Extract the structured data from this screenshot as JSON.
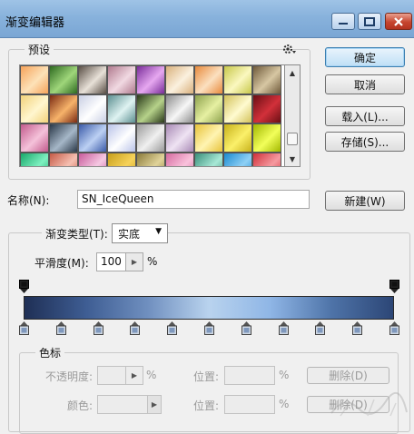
{
  "window": {
    "title": "渐变编辑器"
  },
  "presets": {
    "label": "预设",
    "swatches": [
      [
        "#f6a35a",
        "#fde2b8"
      ],
      [
        "#2e6a20",
        "#9fd67a"
      ],
      [
        "#5a4f46",
        "#e8e1d8"
      ],
      [
        "#b07a8e",
        "#f1d9e2"
      ],
      [
        "#7a2d9a",
        "#e6a8f0"
      ],
      [
        "#d9b07c",
        "#fbf1df"
      ],
      [
        "#e88a3c",
        "#fbe0c0"
      ],
      [
        "#c8c84a",
        "#fbf8c0"
      ],
      [
        "#6f5a3a",
        "#d7c7a3"
      ],
      [
        "#f2d27a",
        "#fff6cf"
      ],
      [
        "#7a2a12",
        "#f7b36a"
      ],
      [
        "#c9cfe4",
        "#ffffff"
      ],
      [
        "#5d8f91",
        "#dff3f2"
      ],
      [
        "#2a3a1a",
        "#b6d28a"
      ],
      [
        "#8c8c8c",
        "#f7f7f7"
      ],
      [
        "#8ea24d",
        "#e6f0a2"
      ],
      [
        "#d3c25a",
        "#fffbd0"
      ],
      [
        "#6a0f14",
        "#d2303a"
      ],
      [
        "#c25a8c",
        "#f5c2da"
      ],
      [
        "#2a3848",
        "#a6b7c8"
      ],
      [
        "#3a5aa8",
        "#bcd0f3"
      ],
      [
        "#b9c3e9",
        "#ffffff"
      ],
      [
        "#9a9a9a",
        "#f0f0f0"
      ],
      [
        "#a889b5",
        "#efe3f3"
      ],
      [
        "#e7c33a",
        "#fff4b2"
      ],
      [
        "#c8b21a",
        "#fbf06a"
      ],
      [
        "#a2b800",
        "#f2ff5a"
      ],
      [
        "#18a86a",
        "#7ef0c0"
      ],
      [
        "#c55a46",
        "#f6c0b2"
      ],
      [
        "#c85a9a",
        "#f5c8e2"
      ],
      [
        "#c79f1a",
        "#f6d25a"
      ],
      [
        "#8a7a3a",
        "#e0d39a"
      ],
      [
        "#d66aa0",
        "#f9c2dc"
      ],
      [
        "#3a8f7a",
        "#a8e8d6"
      ],
      [
        "#1a8ad0",
        "#8fd0f5"
      ],
      [
        "#d0303a",
        "#f59aa0"
      ]
    ],
    "gear_icon": "gear-icon"
  },
  "buttons": {
    "ok": "确定",
    "cancel": "取消",
    "load": "载入(L)...",
    "save": "存储(S)...",
    "new": "新建(W)"
  },
  "name_field": {
    "label": "名称(N):",
    "value": "SN_IceQueen"
  },
  "gradient": {
    "type_label": "渐变类型(T):",
    "type_value": "实底",
    "smoothness_label": "平滑度(M):",
    "smoothness_value": "100",
    "smoothness_unit": "%",
    "colors": [
      "#1f2f55",
      "#3e5d93",
      "#6f8fbf",
      "#b9d3ee",
      "#8fb6e6",
      "#4e73a8",
      "#2c4676"
    ],
    "opacity_stop_count": 2,
    "color_stop_count": 11
  },
  "stops_panel": {
    "label": "色标",
    "opacity_label": "不透明度:",
    "opacity_unit": "%",
    "color_label": "颜色:",
    "position_label": "位置:",
    "position_unit": "%",
    "delete_label": "删除(D)"
  }
}
